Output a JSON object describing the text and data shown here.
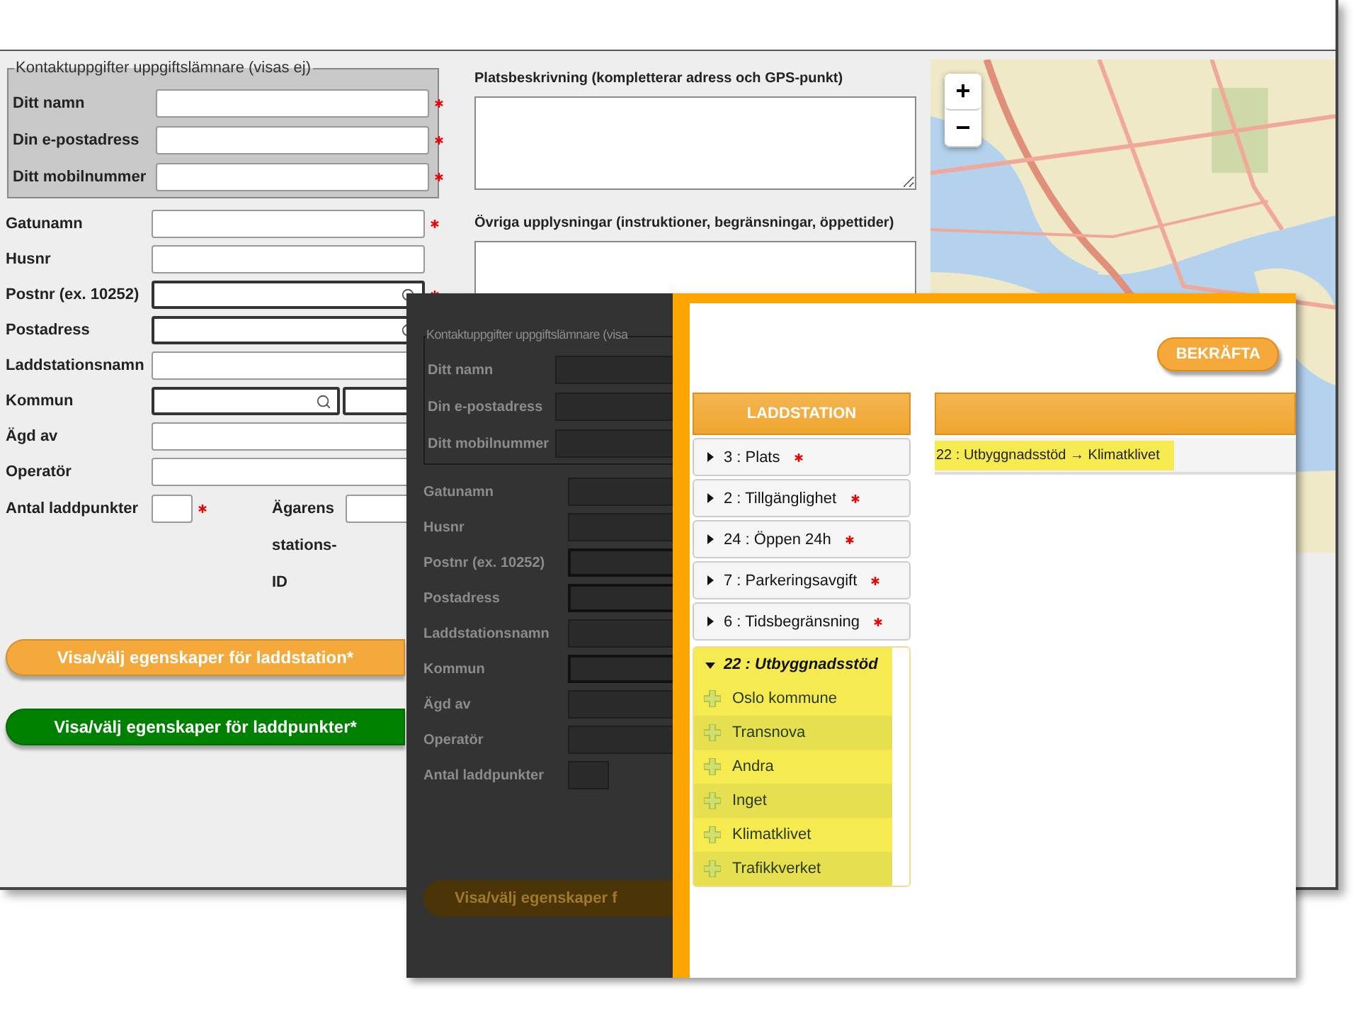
{
  "back_window": {
    "contact": {
      "legend": "Kontaktuppgifter uppgiftslämnare (visas ej)",
      "fields": [
        {
          "label": "Ditt namn",
          "required": true
        },
        {
          "label": "Din e-postadress",
          "required": true
        },
        {
          "label": "Ditt mobilnummer",
          "required": true
        }
      ]
    },
    "address_fields": [
      {
        "label": "Gatunamn",
        "required": true,
        "kind": "text"
      },
      {
        "label": "Husnr",
        "required": false,
        "kind": "text"
      },
      {
        "label": "Postnr (ex. 10252)",
        "required": true,
        "kind": "search"
      },
      {
        "label": "Postadress",
        "required": false,
        "kind": "search"
      },
      {
        "label": "Laddstationsnamn",
        "required": false,
        "kind": "text"
      },
      {
        "label": "Kommun",
        "required": false,
        "kind": "double_search"
      },
      {
        "label": "Ägd av",
        "required": false,
        "kind": "text"
      },
      {
        "label": "Operatör",
        "required": false,
        "kind": "text"
      }
    ],
    "count_field": {
      "label": "Antal laddpunkter",
      "required": true
    },
    "owner_id_label": "Ägarens stations-ID",
    "buttons": [
      {
        "label": "Visa/välj egenskaper för laddstation*",
        "color": "#f5a93a"
      },
      {
        "label": "Visa/välj egenskaper för laddpunkter*",
        "color": "#008000"
      }
    ],
    "description_label": "Platsbeskrivning (kompletterar adress och GPS-punkt)",
    "notes_label": "Övriga upplysningar (instruktioner, begränsningar, öppettider)",
    "map": {
      "zoom_in": "+",
      "zoom_out": "−"
    }
  },
  "front_window": {
    "dim_form": {
      "legend": "Kontaktuppgifter uppgiftslämnare (visa",
      "contact_labels": [
        "Ditt namn",
        "Din e-postadress",
        "Ditt mobilnummer"
      ],
      "labels": [
        "Gatunamn",
        "Husnr",
        "Postnr (ex. 10252)",
        "Postadress",
        "Laddstationsnamn",
        "Kommun",
        "Ägd av",
        "Operatör",
        "Antal laddpunkter"
      ],
      "button": "Visa/välj egenskaper f"
    },
    "confirm_button": "BEKRÄFTA",
    "list_title": "LADDSTATION",
    "items": [
      {
        "label": "3 : Plats",
        "required": true,
        "expanded": false
      },
      {
        "label": "2 : Tillgänglighet",
        "required": true,
        "expanded": false
      },
      {
        "label": "24 : Öppen 24h",
        "required": true,
        "expanded": false
      },
      {
        "label": "7 : Parkeringsavgift",
        "required": true,
        "expanded": false
      },
      {
        "label": "6 : Tidsbegränsning",
        "required": true,
        "expanded": false
      },
      {
        "label": "22 : Utbyggnadsstöd",
        "required": false,
        "expanded": true,
        "children": [
          {
            "label": "Oslo kommune"
          },
          {
            "label": "Transnova"
          },
          {
            "label": "Andra"
          },
          {
            "label": "Inget"
          },
          {
            "label": "Klimatklivet"
          },
          {
            "label": "Trafikkverket"
          }
        ]
      }
    ],
    "selection": [
      "22 : Utbyggnadsstöd → Klimatklivet"
    ]
  }
}
